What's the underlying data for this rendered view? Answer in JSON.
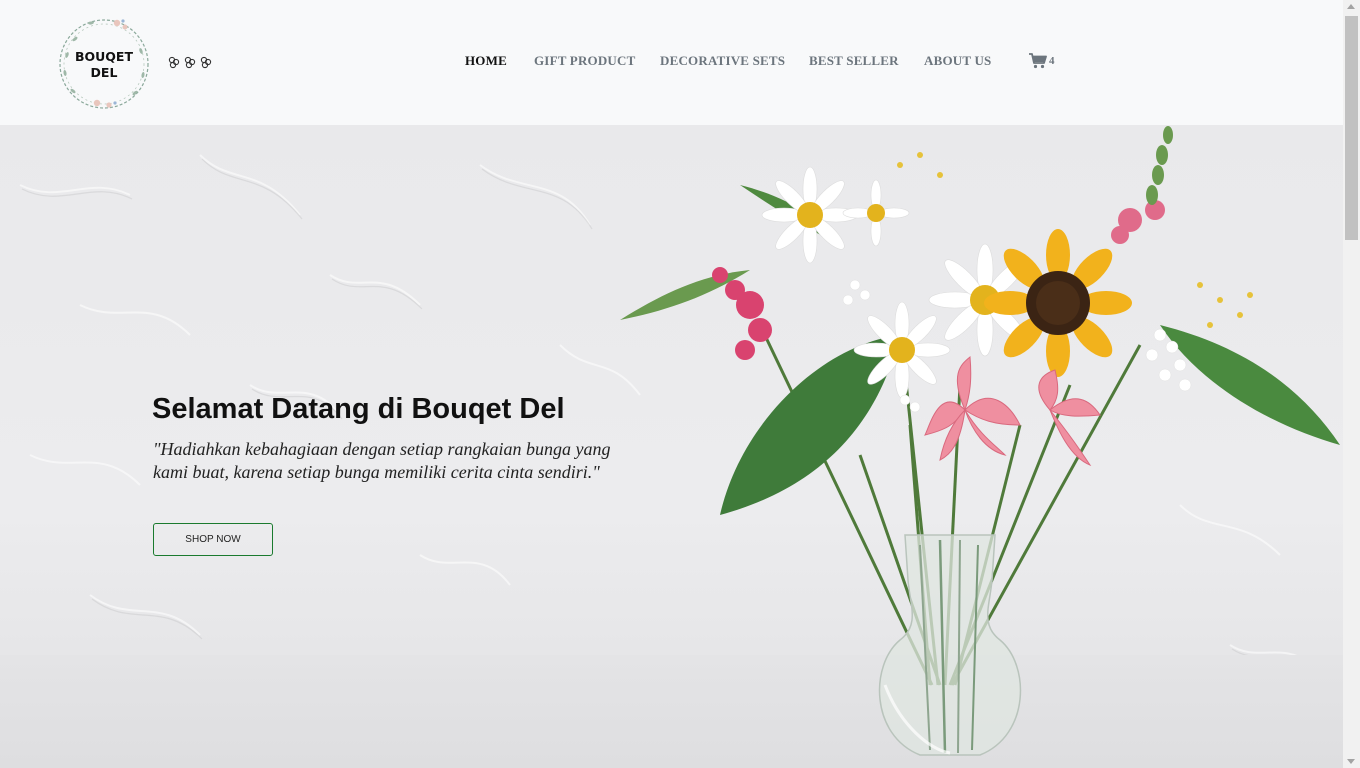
{
  "brand": {
    "logo_line1": "BOUQET",
    "logo_line2": "DEL"
  },
  "nav": {
    "items": [
      {
        "label": "HOME",
        "active": true
      },
      {
        "label": "GIFT PRODUCT",
        "active": false
      },
      {
        "label": "DECORATIVE SETS",
        "active": false
      },
      {
        "label": "BEST SELLER",
        "active": false
      },
      {
        "label": "ABOUT US",
        "active": false
      }
    ],
    "cart_icon": "shopping-cart-icon",
    "cart_count": "4"
  },
  "hero": {
    "title": "Selamat Datang di Bouqet Del",
    "quote": "\"Hadiahkan kebahagiaan dengan setiap rangkaian bunga yang kami buat, karena setiap bunga memiliki cerita cinta sendiri.\"",
    "button_label": "SHOP NOW"
  },
  "colors": {
    "header_bg": "#f8f9fa",
    "nav_active": "#111111",
    "nav_inactive": "#6c757d",
    "button_border": "#1a7a2e"
  }
}
